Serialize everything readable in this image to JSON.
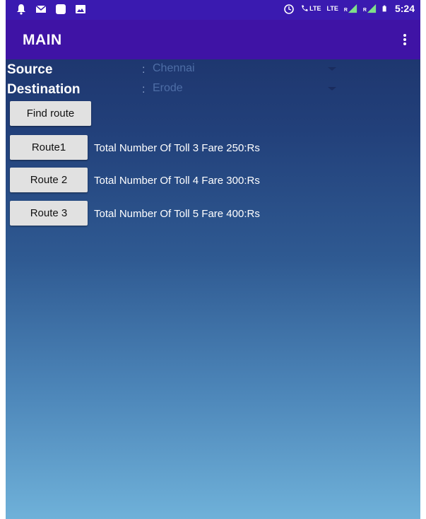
{
  "status_bar": {
    "time": "5:24",
    "volte_label": "LTE",
    "lte_label": "LTE",
    "roaming_label_1": "R",
    "roaming_label_2": "R",
    "icons": [
      "notification-bell-icon",
      "email-icon",
      "square-app-icon",
      "image-icon",
      "alarm-icon",
      "volte-call-icon",
      "signal-icon",
      "battery-icon"
    ]
  },
  "app_bar": {
    "title": "MAIN",
    "menu_icon": "overflow-menu-icon"
  },
  "form": {
    "source_label": "Source",
    "source_colon": ":",
    "source_value": "Chennai",
    "destination_label": "Destination",
    "destination_colon": ":",
    "destination_value": "Erode"
  },
  "find_route_label": "Find route",
  "routes": [
    {
      "button_label": "Route1",
      "info": "Total Number Of Toll 3 Fare 250:Rs"
    },
    {
      "button_label": "Route 2",
      "info": "Total Number Of Toll 4 Fare 300:Rs"
    },
    {
      "button_label": "Route 3",
      "info": "Total Number Of Toll 5 Fare 400:Rs"
    }
  ],
  "colors": {
    "status_bar": "#3a1ab0",
    "app_bar": "#3f13a5",
    "background_top": "#1b2f66",
    "background_bottom": "#6fb1d9",
    "button": "#e1e1e1"
  }
}
